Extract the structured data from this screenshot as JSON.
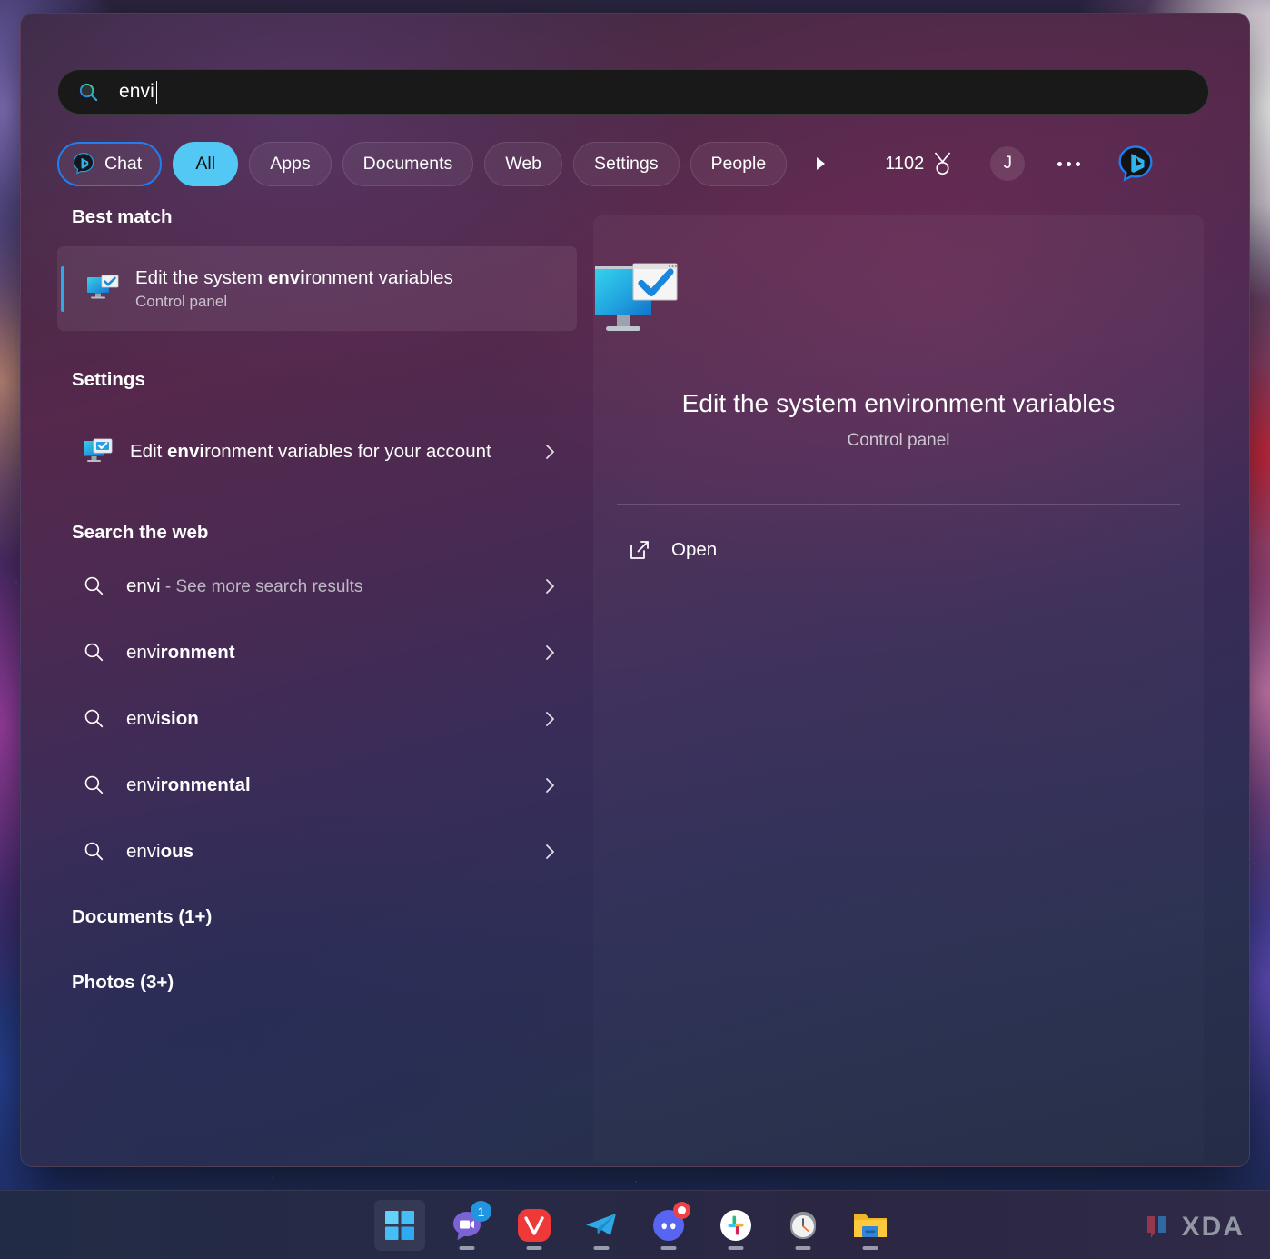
{
  "search": {
    "query": "envi",
    "icon": "search-icon"
  },
  "filters": {
    "chat": {
      "label": "Chat",
      "icon": "bing-chat-icon"
    },
    "tabs": [
      {
        "label": "All",
        "selected": true
      },
      {
        "label": "Apps",
        "selected": false
      },
      {
        "label": "Documents",
        "selected": false
      },
      {
        "label": "Web",
        "selected": false
      },
      {
        "label": "Settings",
        "selected": false
      },
      {
        "label": "People",
        "selected": false
      }
    ],
    "more_icon": "chevron-right-icon",
    "rewards_points": "1102",
    "rewards_icon": "rewards-medal-icon",
    "avatar_initial": "J",
    "overflow_icon": "ellipsis-icon",
    "bing_icon": "bing-icon"
  },
  "results": {
    "best_match_header": "Best match",
    "best_match": {
      "title_prefix": "Edit the system ",
      "title_bold": "envi",
      "title_suffix": "ronment variables",
      "subtitle": "Control panel",
      "icon": "monitor-check-icon"
    },
    "settings_header": "Settings",
    "settings_item": {
      "prefix": "Edit ",
      "bold": "envi",
      "suffix": "ronment variables for your account",
      "icon": "monitor-check-icon",
      "chevron": "chevron-right-icon"
    },
    "web_header": "Search the web",
    "web_items": [
      {
        "plain": "envi",
        "bold": "",
        "note": " - See more search results",
        "icon": "magnifier-icon"
      },
      {
        "plain": "envi",
        "bold": "ronment",
        "note": "",
        "icon": "magnifier-icon"
      },
      {
        "plain": "envi",
        "bold": "sion",
        "note": "",
        "icon": "magnifier-icon"
      },
      {
        "plain": "envi",
        "bold": "ronmental",
        "note": "",
        "icon": "magnifier-icon"
      },
      {
        "plain": "envi",
        "bold": "ous",
        "note": "",
        "icon": "magnifier-icon"
      }
    ],
    "documents_header": "Documents (1+)",
    "photos_header": "Photos (3+)"
  },
  "preview": {
    "icon": "monitor-check-large-icon",
    "title": "Edit the system environment variables",
    "subtitle": "Control panel",
    "open_label": "Open",
    "open_icon": "open-external-icon"
  },
  "taskbar": {
    "items": [
      {
        "name": "start-button",
        "icon": "windows-logo-icon",
        "badge": "",
        "running": false,
        "active": true
      },
      {
        "name": "chat-button",
        "icon": "teams-chat-icon",
        "badge": "1",
        "running": true,
        "active": false
      },
      {
        "name": "vivaldi-button",
        "icon": "vivaldi-icon",
        "badge": "",
        "running": true,
        "active": false
      },
      {
        "name": "telegram-button",
        "icon": "telegram-icon",
        "badge": "",
        "running": true,
        "active": false
      },
      {
        "name": "discord-button",
        "icon": "discord-icon",
        "badge": "dot",
        "running": true,
        "active": false
      },
      {
        "name": "slack-button",
        "icon": "slack-icon",
        "badge": "",
        "running": true,
        "active": false
      },
      {
        "name": "clock-button",
        "icon": "clock-icon",
        "badge": "",
        "running": true,
        "active": false
      },
      {
        "name": "file-explorer-button",
        "icon": "folder-icon",
        "badge": "",
        "running": true,
        "active": false
      }
    ]
  },
  "watermark": {
    "text": "XDA"
  },
  "colors": {
    "accent_blue": "#1f7ff0",
    "selected_pill": "#53c8f5",
    "best_match_accent": "#31a8e8",
    "badge_blue": "#2295e0",
    "badge_red": "#ed4245"
  }
}
